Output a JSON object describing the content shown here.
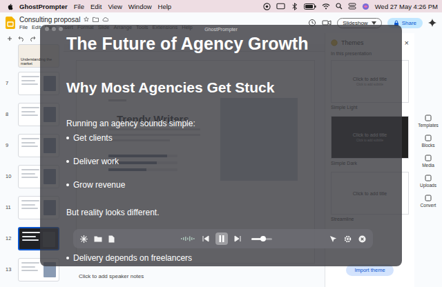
{
  "menubar": {
    "app": "GhostPrompter",
    "menus": [
      "File",
      "Edit",
      "View",
      "Window",
      "Help"
    ],
    "clock": "Wed 27 May 4:26 PM"
  },
  "slides": {
    "title": "Consulting proposal",
    "menus": [
      "File",
      "Edit",
      "View",
      "Insert",
      "Format",
      "Slide",
      "Arrange",
      "Tools",
      "Extensions",
      "Help"
    ],
    "slideshow": "Slideshow",
    "share": "Share",
    "thumbnails": {
      "partial": "Understanding the market",
      "items": [
        {
          "number": "7",
          "selected": false,
          "dark": false
        },
        {
          "number": "8",
          "selected": false,
          "dark": false
        },
        {
          "number": "9",
          "selected": false,
          "dark": false
        },
        {
          "number": "10",
          "selected": false,
          "dark": false
        },
        {
          "number": "11",
          "selected": false,
          "dark": false
        },
        {
          "number": "12",
          "selected": true,
          "dark": true
        },
        {
          "number": "13",
          "selected": false,
          "dark": false
        }
      ]
    },
    "canvas": {
      "title": "Trendy Writers",
      "bars": [
        0.85,
        0.7,
        0.55
      ],
      "notes": "Click to add speaker notes"
    },
    "themes": {
      "title": "Themes",
      "close": "×",
      "section": "In this presentation",
      "items": [
        {
          "label": "Simple Light",
          "dark": false,
          "preview": "Click to add title",
          "subtitle": "Click to add subtitle"
        },
        {
          "label": "Simple Dark",
          "dark": true,
          "preview": "Click to add title",
          "subtitle": "Click to add subtitle"
        },
        {
          "label": "Streamline",
          "dark": false,
          "preview": "Click to add title",
          "subtitle": ""
        }
      ],
      "import": "Import theme"
    },
    "rail": [
      "Templates",
      "Blocks",
      "Media",
      "Uploads",
      "Convert"
    ]
  },
  "prompter": {
    "title": "GhostPrompter",
    "lines": [
      {
        "kind": "title",
        "text": "The Future of Agency Growth"
      },
      {
        "kind": "heading",
        "text": "Why Most Agencies Get Stuck"
      },
      {
        "kind": "text",
        "text": "Running an agency sounds simple:"
      },
      {
        "kind": "bullet",
        "text": "Get clients"
      },
      {
        "kind": "bullet",
        "text": "Deliver work"
      },
      {
        "kind": "bullet",
        "text": "Grow revenue"
      },
      {
        "kind": "text",
        "text": "But reality looks different."
      },
      {
        "kind": "bullet",
        "text": "Delivery depends on freelancers"
      }
    ],
    "controls": {
      "playing": true,
      "level": 0.57
    }
  }
}
